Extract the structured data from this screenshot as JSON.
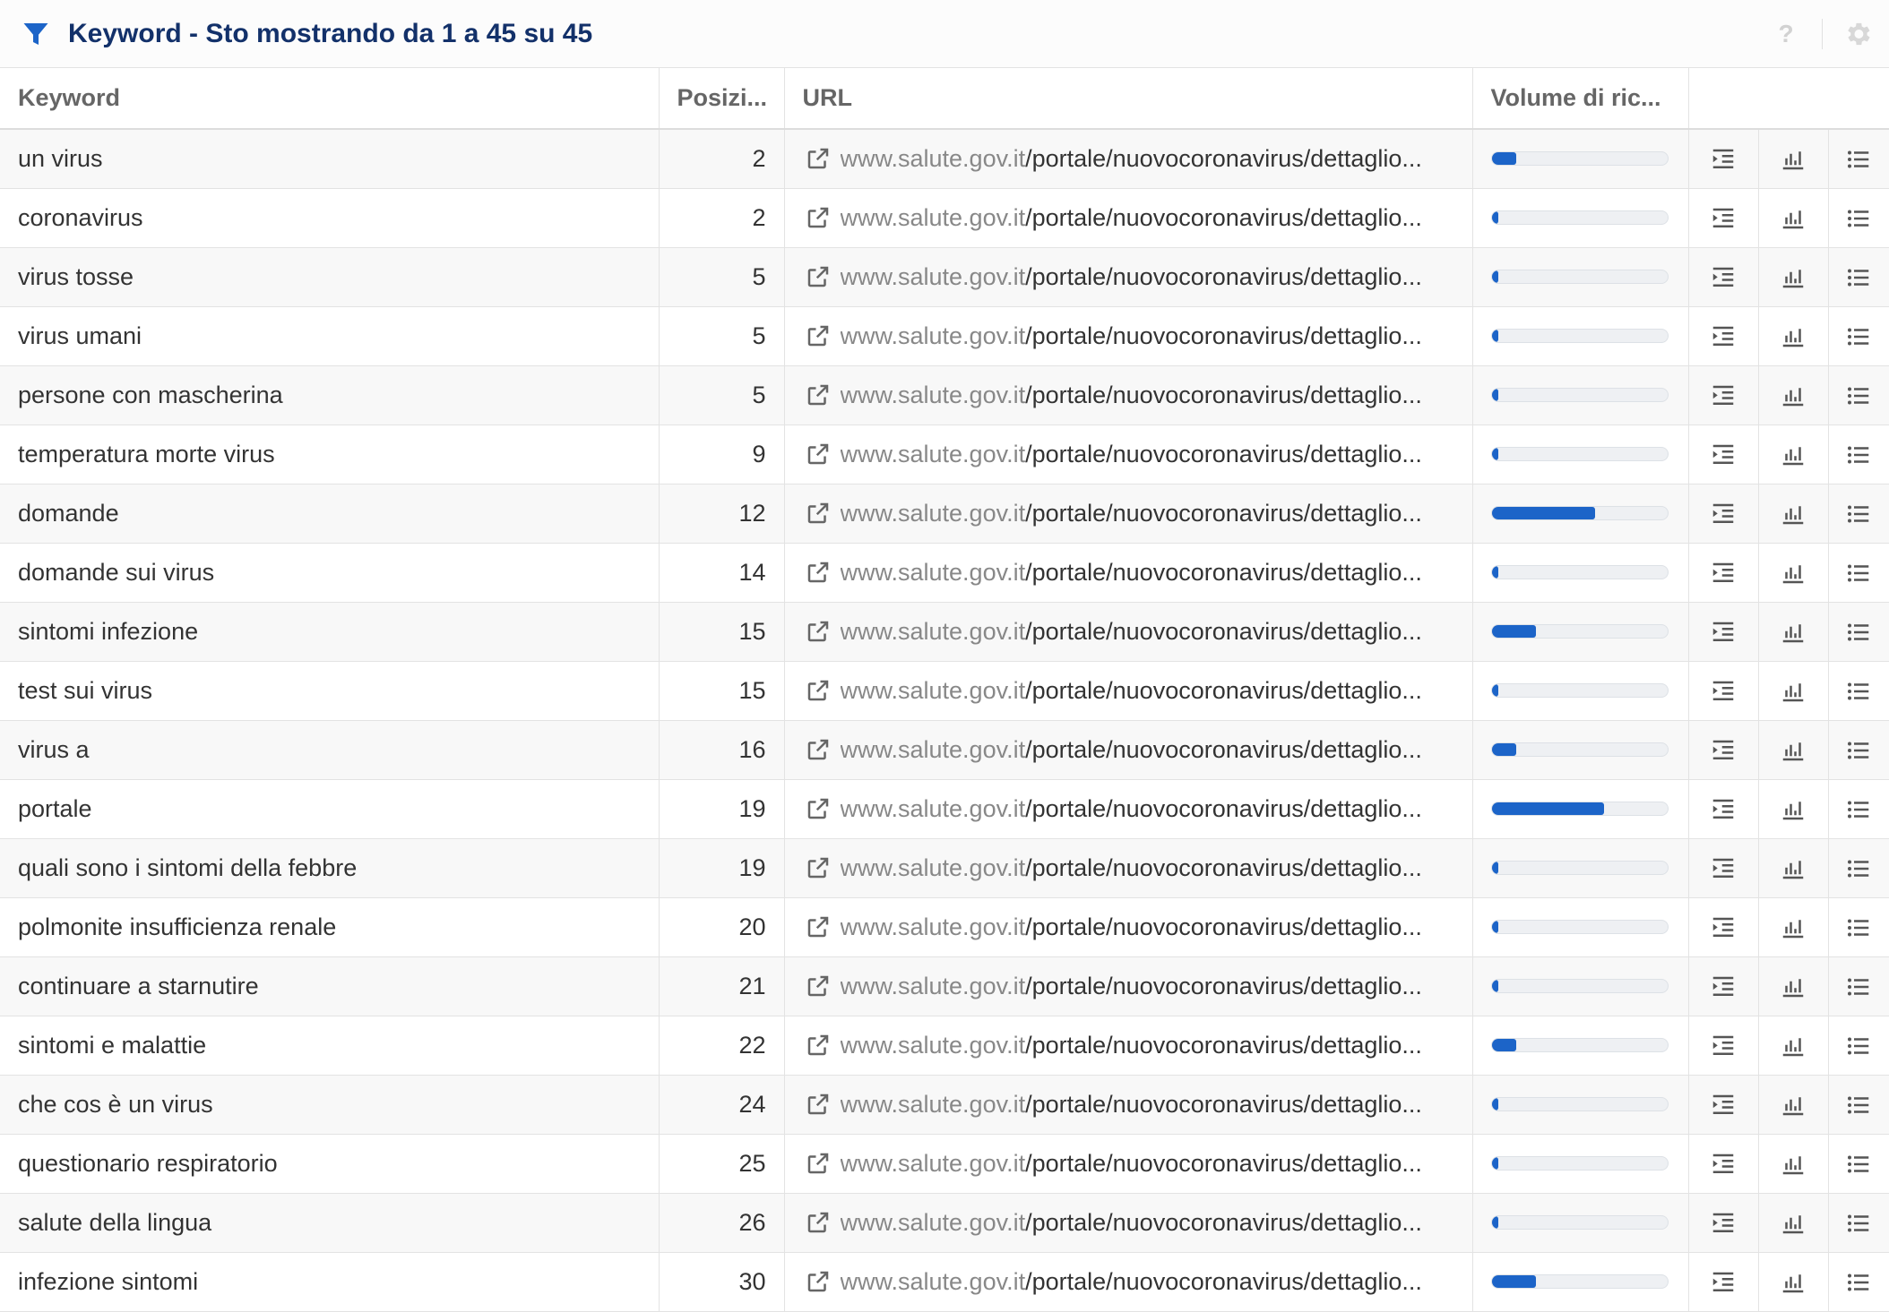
{
  "header": {
    "title": "Keyword - Sto mostrando da 1 a 45 su 45",
    "help_label": "?"
  },
  "columns": {
    "keyword": "Keyword",
    "position": "Posizi...",
    "url": "URL",
    "volume": "Volume di ric..."
  },
  "colors": {
    "accent": "#1c64c8",
    "title": "#13316a",
    "url_host": "#888888"
  },
  "icons": [
    "filter-icon",
    "help-icon",
    "gear-icon",
    "external-link-icon",
    "indent-icon",
    "bar-chart-icon",
    "list-icon"
  ],
  "rows": [
    {
      "keyword": "un virus",
      "position": "2",
      "url_host": "www.salute.gov.it",
      "url_path": "/portale/nuovocoronavirus/dettaglio...",
      "volume_fraction": 0.14
    },
    {
      "keyword": "coronavirus",
      "position": "2",
      "url_host": "www.salute.gov.it",
      "url_path": "/portale/nuovocoronavirus/dettaglio...",
      "volume_fraction": 0.04
    },
    {
      "keyword": "virus tosse",
      "position": "5",
      "url_host": "www.salute.gov.it",
      "url_path": "/portale/nuovocoronavirus/dettaglio...",
      "volume_fraction": 0.04
    },
    {
      "keyword": "virus umani",
      "position": "5",
      "url_host": "www.salute.gov.it",
      "url_path": "/portale/nuovocoronavirus/dettaglio...",
      "volume_fraction": 0.04
    },
    {
      "keyword": "persone con mascherina",
      "position": "5",
      "url_host": "www.salute.gov.it",
      "url_path": "/portale/nuovocoronavirus/dettaglio...",
      "volume_fraction": 0.04
    },
    {
      "keyword": "temperatura morte virus",
      "position": "9",
      "url_host": "www.salute.gov.it",
      "url_path": "/portale/nuovocoronavirus/dettaglio...",
      "volume_fraction": 0.04
    },
    {
      "keyword": "domande",
      "position": "12",
      "url_host": "www.salute.gov.it",
      "url_path": "/portale/nuovocoronavirus/dettaglio...",
      "volume_fraction": 0.59
    },
    {
      "keyword": "domande sui virus",
      "position": "14",
      "url_host": "www.salute.gov.it",
      "url_path": "/portale/nuovocoronavirus/dettaglio...",
      "volume_fraction": 0.04
    },
    {
      "keyword": "sintomi infezione",
      "position": "15",
      "url_host": "www.salute.gov.it",
      "url_path": "/portale/nuovocoronavirus/dettaglio...",
      "volume_fraction": 0.25
    },
    {
      "keyword": "test sui virus",
      "position": "15",
      "url_host": "www.salute.gov.it",
      "url_path": "/portale/nuovocoronavirus/dettaglio...",
      "volume_fraction": 0.04
    },
    {
      "keyword": "virus a",
      "position": "16",
      "url_host": "www.salute.gov.it",
      "url_path": "/portale/nuovocoronavirus/dettaglio...",
      "volume_fraction": 0.14
    },
    {
      "keyword": "portale",
      "position": "19",
      "url_host": "www.salute.gov.it",
      "url_path": "/portale/nuovocoronavirus/dettaglio...",
      "volume_fraction": 0.64
    },
    {
      "keyword": "quali sono i sintomi della febbre",
      "position": "19",
      "url_host": "www.salute.gov.it",
      "url_path": "/portale/nuovocoronavirus/dettaglio...",
      "volume_fraction": 0.04
    },
    {
      "keyword": "polmonite insufficienza renale",
      "position": "20",
      "url_host": "www.salute.gov.it",
      "url_path": "/portale/nuovocoronavirus/dettaglio...",
      "volume_fraction": 0.04
    },
    {
      "keyword": "continuare a starnutire",
      "position": "21",
      "url_host": "www.salute.gov.it",
      "url_path": "/portale/nuovocoronavirus/dettaglio...",
      "volume_fraction": 0.04
    },
    {
      "keyword": "sintomi e malattie",
      "position": "22",
      "url_host": "www.salute.gov.it",
      "url_path": "/portale/nuovocoronavirus/dettaglio...",
      "volume_fraction": 0.14
    },
    {
      "keyword": "che cos è un virus",
      "position": "24",
      "url_host": "www.salute.gov.it",
      "url_path": "/portale/nuovocoronavirus/dettaglio...",
      "volume_fraction": 0.04
    },
    {
      "keyword": "questionario respiratorio",
      "position": "25",
      "url_host": "www.salute.gov.it",
      "url_path": "/portale/nuovocoronavirus/dettaglio...",
      "volume_fraction": 0.04
    },
    {
      "keyword": "salute della lingua",
      "position": "26",
      "url_host": "www.salute.gov.it",
      "url_path": "/portale/nuovocoronavirus/dettaglio...",
      "volume_fraction": 0.04
    },
    {
      "keyword": "infezione sintomi",
      "position": "30",
      "url_host": "www.salute.gov.it",
      "url_path": "/portale/nuovocoronavirus/dettaglio...",
      "volume_fraction": 0.25
    }
  ]
}
